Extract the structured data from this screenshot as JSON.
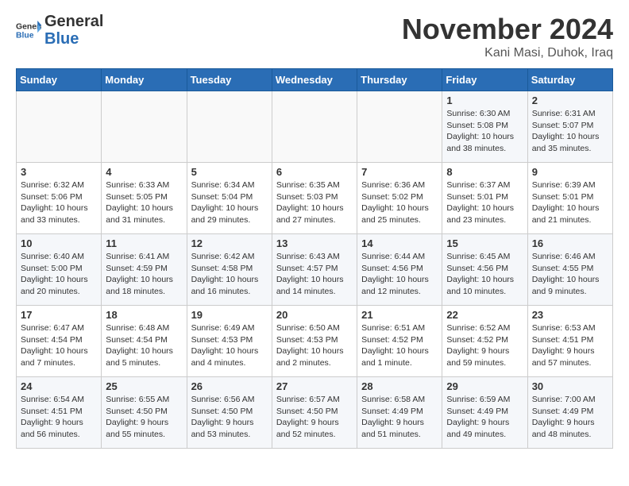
{
  "header": {
    "logo_line1": "General",
    "logo_line2": "Blue",
    "month_title": "November 2024",
    "location": "Kani Masi, Duhok, Iraq"
  },
  "weekdays": [
    "Sunday",
    "Monday",
    "Tuesday",
    "Wednesday",
    "Thursday",
    "Friday",
    "Saturday"
  ],
  "weeks": [
    [
      {
        "day": "",
        "sunrise": "",
        "sunset": "",
        "daylight": ""
      },
      {
        "day": "",
        "sunrise": "",
        "sunset": "",
        "daylight": ""
      },
      {
        "day": "",
        "sunrise": "",
        "sunset": "",
        "daylight": ""
      },
      {
        "day": "",
        "sunrise": "",
        "sunset": "",
        "daylight": ""
      },
      {
        "day": "",
        "sunrise": "",
        "sunset": "",
        "daylight": ""
      },
      {
        "day": "1",
        "sunrise": "Sunrise: 6:30 AM",
        "sunset": "Sunset: 5:08 PM",
        "daylight": "Daylight: 10 hours and 38 minutes."
      },
      {
        "day": "2",
        "sunrise": "Sunrise: 6:31 AM",
        "sunset": "Sunset: 5:07 PM",
        "daylight": "Daylight: 10 hours and 35 minutes."
      }
    ],
    [
      {
        "day": "3",
        "sunrise": "Sunrise: 6:32 AM",
        "sunset": "Sunset: 5:06 PM",
        "daylight": "Daylight: 10 hours and 33 minutes."
      },
      {
        "day": "4",
        "sunrise": "Sunrise: 6:33 AM",
        "sunset": "Sunset: 5:05 PM",
        "daylight": "Daylight: 10 hours and 31 minutes."
      },
      {
        "day": "5",
        "sunrise": "Sunrise: 6:34 AM",
        "sunset": "Sunset: 5:04 PM",
        "daylight": "Daylight: 10 hours and 29 minutes."
      },
      {
        "day": "6",
        "sunrise": "Sunrise: 6:35 AM",
        "sunset": "Sunset: 5:03 PM",
        "daylight": "Daylight: 10 hours and 27 minutes."
      },
      {
        "day": "7",
        "sunrise": "Sunrise: 6:36 AM",
        "sunset": "Sunset: 5:02 PM",
        "daylight": "Daylight: 10 hours and 25 minutes."
      },
      {
        "day": "8",
        "sunrise": "Sunrise: 6:37 AM",
        "sunset": "Sunset: 5:01 PM",
        "daylight": "Daylight: 10 hours and 23 minutes."
      },
      {
        "day": "9",
        "sunrise": "Sunrise: 6:39 AM",
        "sunset": "Sunset: 5:01 PM",
        "daylight": "Daylight: 10 hours and 21 minutes."
      }
    ],
    [
      {
        "day": "10",
        "sunrise": "Sunrise: 6:40 AM",
        "sunset": "Sunset: 5:00 PM",
        "daylight": "Daylight: 10 hours and 20 minutes."
      },
      {
        "day": "11",
        "sunrise": "Sunrise: 6:41 AM",
        "sunset": "Sunset: 4:59 PM",
        "daylight": "Daylight: 10 hours and 18 minutes."
      },
      {
        "day": "12",
        "sunrise": "Sunrise: 6:42 AM",
        "sunset": "Sunset: 4:58 PM",
        "daylight": "Daylight: 10 hours and 16 minutes."
      },
      {
        "day": "13",
        "sunrise": "Sunrise: 6:43 AM",
        "sunset": "Sunset: 4:57 PM",
        "daylight": "Daylight: 10 hours and 14 minutes."
      },
      {
        "day": "14",
        "sunrise": "Sunrise: 6:44 AM",
        "sunset": "Sunset: 4:56 PM",
        "daylight": "Daylight: 10 hours and 12 minutes."
      },
      {
        "day": "15",
        "sunrise": "Sunrise: 6:45 AM",
        "sunset": "Sunset: 4:56 PM",
        "daylight": "Daylight: 10 hours and 10 minutes."
      },
      {
        "day": "16",
        "sunrise": "Sunrise: 6:46 AM",
        "sunset": "Sunset: 4:55 PM",
        "daylight": "Daylight: 10 hours and 9 minutes."
      }
    ],
    [
      {
        "day": "17",
        "sunrise": "Sunrise: 6:47 AM",
        "sunset": "Sunset: 4:54 PM",
        "daylight": "Daylight: 10 hours and 7 minutes."
      },
      {
        "day": "18",
        "sunrise": "Sunrise: 6:48 AM",
        "sunset": "Sunset: 4:54 PM",
        "daylight": "Daylight: 10 hours and 5 minutes."
      },
      {
        "day": "19",
        "sunrise": "Sunrise: 6:49 AM",
        "sunset": "Sunset: 4:53 PM",
        "daylight": "Daylight: 10 hours and 4 minutes."
      },
      {
        "day": "20",
        "sunrise": "Sunrise: 6:50 AM",
        "sunset": "Sunset: 4:53 PM",
        "daylight": "Daylight: 10 hours and 2 minutes."
      },
      {
        "day": "21",
        "sunrise": "Sunrise: 6:51 AM",
        "sunset": "Sunset: 4:52 PM",
        "daylight": "Daylight: 10 hours and 1 minute."
      },
      {
        "day": "22",
        "sunrise": "Sunrise: 6:52 AM",
        "sunset": "Sunset: 4:52 PM",
        "daylight": "Daylight: 9 hours and 59 minutes."
      },
      {
        "day": "23",
        "sunrise": "Sunrise: 6:53 AM",
        "sunset": "Sunset: 4:51 PM",
        "daylight": "Daylight: 9 hours and 57 minutes."
      }
    ],
    [
      {
        "day": "24",
        "sunrise": "Sunrise: 6:54 AM",
        "sunset": "Sunset: 4:51 PM",
        "daylight": "Daylight: 9 hours and 56 minutes."
      },
      {
        "day": "25",
        "sunrise": "Sunrise: 6:55 AM",
        "sunset": "Sunset: 4:50 PM",
        "daylight": "Daylight: 9 hours and 55 minutes."
      },
      {
        "day": "26",
        "sunrise": "Sunrise: 6:56 AM",
        "sunset": "Sunset: 4:50 PM",
        "daylight": "Daylight: 9 hours and 53 minutes."
      },
      {
        "day": "27",
        "sunrise": "Sunrise: 6:57 AM",
        "sunset": "Sunset: 4:50 PM",
        "daylight": "Daylight: 9 hours and 52 minutes."
      },
      {
        "day": "28",
        "sunrise": "Sunrise: 6:58 AM",
        "sunset": "Sunset: 4:49 PM",
        "daylight": "Daylight: 9 hours and 51 minutes."
      },
      {
        "day": "29",
        "sunrise": "Sunrise: 6:59 AM",
        "sunset": "Sunset: 4:49 PM",
        "daylight": "Daylight: 9 hours and 49 minutes."
      },
      {
        "day": "30",
        "sunrise": "Sunrise: 7:00 AM",
        "sunset": "Sunset: 4:49 PM",
        "daylight": "Daylight: 9 hours and 48 minutes."
      }
    ]
  ]
}
